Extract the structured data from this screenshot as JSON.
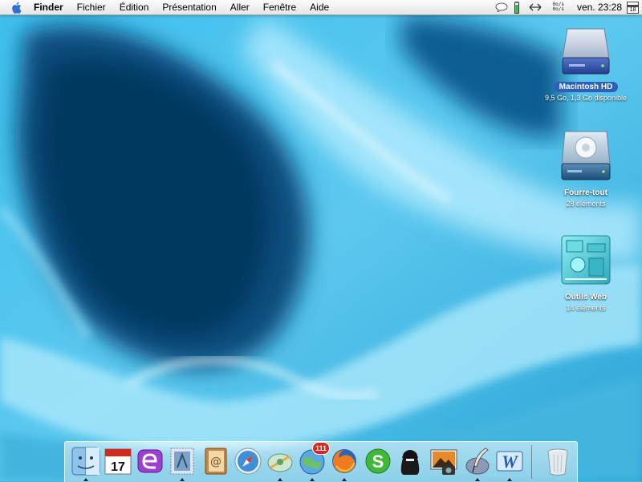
{
  "menubar": {
    "app_name": "Finder",
    "menus": [
      "Fichier",
      "Édition",
      "Présentation",
      "Aller",
      "Fenêtre",
      "Aide"
    ],
    "net_up": "0o/s",
    "net_down": "0o/s",
    "clock": "ven. 23:28",
    "calendar_day": "18"
  },
  "desktop": {
    "icons": [
      {
        "name": "Macintosh HD",
        "info": "9,5 Go, 1,3 Go disponible",
        "icon": "hard-drive-icon"
      },
      {
        "name": "Fourre-tout",
        "info": "28 éléments",
        "icon": "ipod-drive-icon"
      },
      {
        "name": "Outils Web",
        "info": "14 éléments",
        "icon": "folder-icon"
      }
    ]
  },
  "dock": {
    "items": [
      {
        "name": "finder",
        "icon": "finder-icon",
        "running": true
      },
      {
        "name": "ical",
        "icon": "calendar-icon",
        "label": "17",
        "running": false
      },
      {
        "name": "mail-app",
        "icon": "purple-e-icon",
        "running": false
      },
      {
        "name": "mail-stamp",
        "icon": "stamp-icon",
        "running": true
      },
      {
        "name": "address-book",
        "icon": "address-book-icon",
        "running": false
      },
      {
        "name": "safari",
        "icon": "compass-icon",
        "running": false
      },
      {
        "name": "network-tool",
        "icon": "satellite-icon",
        "running": true
      },
      {
        "name": "messages-globe",
        "icon": "globe-icon",
        "badge": "111",
        "running": true
      },
      {
        "name": "firefox",
        "icon": "firefox-icon",
        "running": true
      },
      {
        "name": "skype",
        "icon": "skype-icon",
        "running": false
      },
      {
        "name": "spy-app",
        "icon": "spy-icon",
        "running": false
      },
      {
        "name": "iphoto",
        "icon": "photo-icon",
        "running": false
      },
      {
        "name": "script-editor",
        "icon": "quill-icon",
        "running": true
      },
      {
        "name": "word",
        "icon": "word-icon",
        "running": true
      },
      {
        "name": "trash",
        "icon": "trash-icon",
        "running": false
      }
    ]
  },
  "colors": {
    "wallpaper_light": "#aee8fb",
    "wallpaper_mid": "#3fb8e3",
    "wallpaper_dark": "#0a5c8d",
    "selection": "#2f5fb8"
  }
}
